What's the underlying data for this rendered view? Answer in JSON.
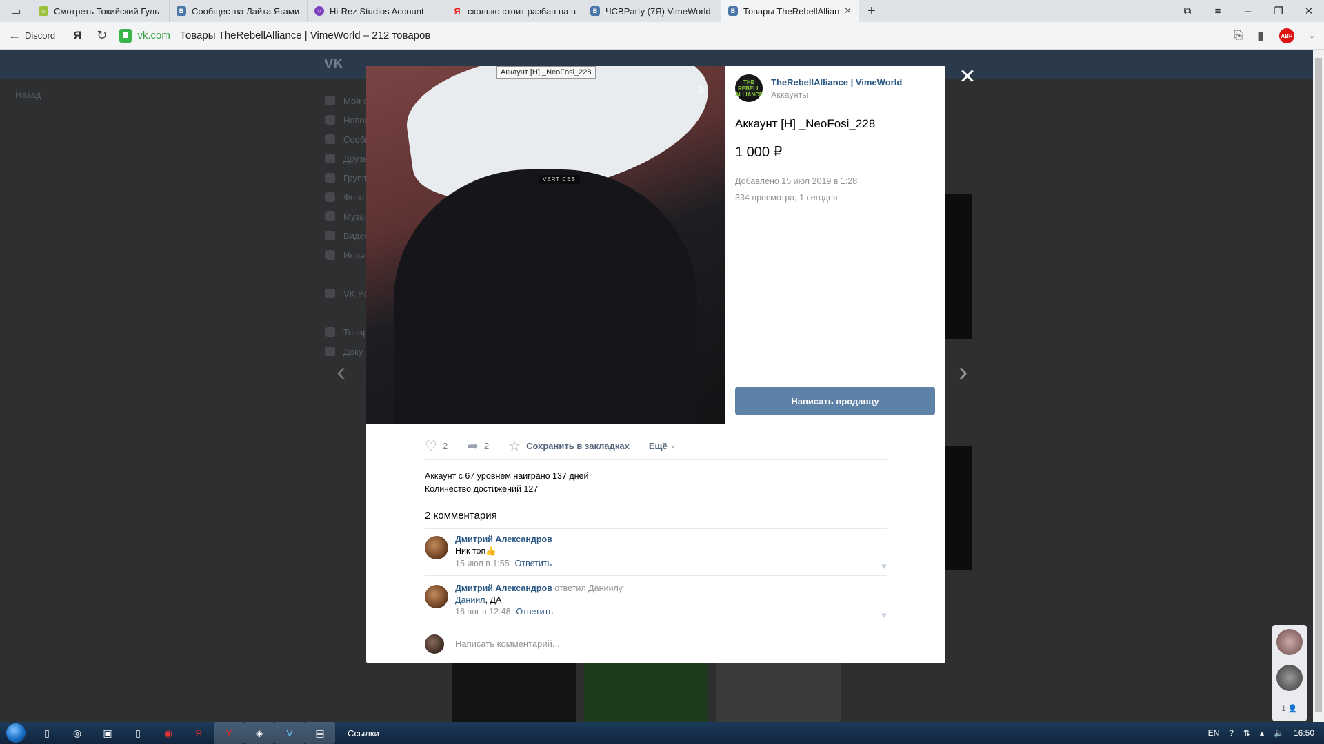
{
  "tabs": [
    {
      "label": "Смотреть Токийский Гуль",
      "color": "#9bc13c",
      "glyph": "☼"
    },
    {
      "label": "Сообщества Лайта Ягами",
      "color": "#4a76a8",
      "glyph": "vk"
    },
    {
      "label": "Hi-Rez Studios Account",
      "color": "#7b3fbf",
      "glyph": "●"
    },
    {
      "label": "сколько стоит разбан на в",
      "color": "#e52620",
      "glyph": "Я"
    },
    {
      "label": "ЧСВParty (7Я) VimeWorld",
      "color": "#4a76a8",
      "glyph": "vk"
    },
    {
      "label": "Товары TheRebellAlliance",
      "color": "#4a76a8",
      "glyph": "vk"
    }
  ],
  "address": {
    "back_label": "Discord",
    "ya": "Я",
    "domain": "vk.com",
    "title": "Товары TheRebellAlliance | VimeWorld – 212 товаров"
  },
  "background": {
    "back": "Назад",
    "menu": [
      "Моя с",
      "Новос",
      "Сообщ",
      "Друзь",
      "Групп",
      "Фото",
      "Музы",
      "Видео",
      "Игры",
      "",
      "VK Pa",
      "",
      "Товар",
      "Доку"
    ]
  },
  "product": {
    "seller_name": "TheRebellAlliance | VimeWorld",
    "seller_category": "Аккаунты",
    "seller_logo_text": "THE REBELL ALLIANCE",
    "title": "Аккаунт [Н] _NeoFosi_228",
    "tooltip": "Аккаунт [Н] _NeoFosi_228",
    "price": "1 000 ₽",
    "added": "Добавлено 15 июл 2019 в 1:28",
    "views": "334 просмотра, 1 сегодня",
    "contact_button": "Написать продавцу",
    "photo_tag": "VERTICES"
  },
  "actions": {
    "likes": "2",
    "shares": "2",
    "save": "Сохранить в закладках",
    "more": "Ещё"
  },
  "description": {
    "line1": "Аккаунт с 67 уровнем наиграно 137 дней",
    "line2": "Количество достижений 127"
  },
  "comments": {
    "title": "2 комментария",
    "items": [
      {
        "author": "Дмитрий Александров",
        "reply_to": "",
        "mention": "",
        "text": "Ник топ👍",
        "time": "15 июл в 1:55",
        "reply": "Ответить"
      },
      {
        "author": "Дмитрий Александров",
        "reply_to": "ответил Даниилу",
        "mention": "Даниил",
        "text": ", ДА",
        "time": "16 авг в 12:48",
        "reply": "Ответить"
      }
    ],
    "write_placeholder": "Написать комментарий..."
  },
  "chats": {
    "count": "1"
  },
  "taskbar": {
    "links": "Ссылки",
    "lang": "EN",
    "time": "16:50"
  }
}
